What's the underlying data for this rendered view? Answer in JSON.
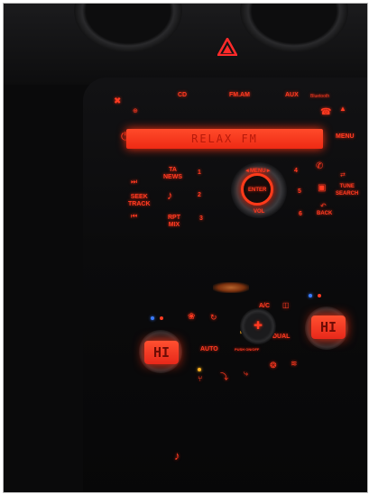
{
  "radio": {
    "source_buttons": {
      "cd": "CD",
      "fm_am": "FM.AM",
      "aux": "AUX",
      "bluetooth": "Bluetooth"
    },
    "display_text": "RELAX FM",
    "left_buttons": {
      "ta_news": "TA\nNEWS",
      "seek_track": "SEEK\nTRACK",
      "rpt_mix": "RPT\nMIX"
    },
    "presets": [
      "1",
      "2",
      "3",
      "4",
      "5",
      "6"
    ],
    "knob": {
      "menu": "◄MENU►",
      "enter": "ENTER",
      "vol": "VOL"
    },
    "right_buttons": {
      "menu": "MENU",
      "tune_search": "TUNE\nSEARCH",
      "back": "BACK"
    }
  },
  "climate": {
    "left_display": "HI",
    "right_display": "HI",
    "auto": "AUTO",
    "ac": "A/C",
    "dual": "DUAL",
    "push_label": "PUSH ON/OFF"
  },
  "colors": {
    "backlight": "#ff3b22",
    "display": "#ff4a2a",
    "amber_indicator": "#ffb020",
    "blue_led": "#3a7bff"
  },
  "icons": [
    "hazard-icon",
    "mute-icon",
    "power-icon",
    "next-track-icon",
    "prev-track-icon",
    "music-note-icon",
    "phone-icon",
    "hang-up-icon",
    "fan-icon",
    "recirculation-icon",
    "defrost-icon",
    "seat-icon"
  ]
}
